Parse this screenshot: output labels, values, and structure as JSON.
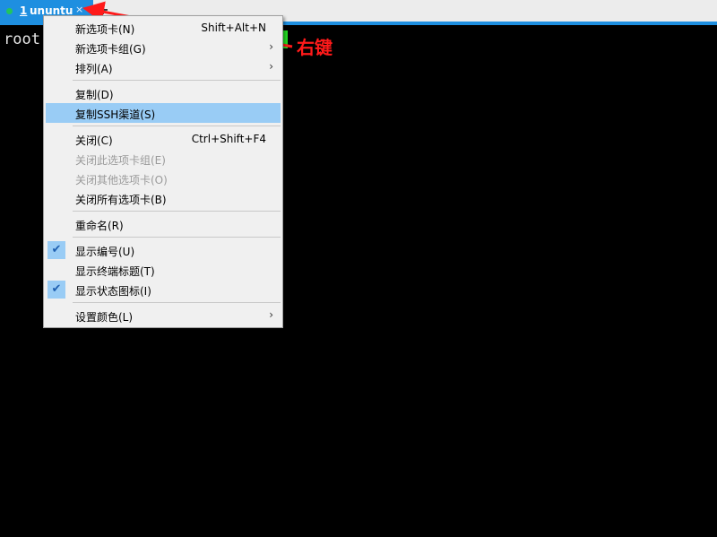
{
  "tabbar": {
    "tab": {
      "number": "1",
      "name": "ununtu",
      "close": "×"
    },
    "new_tab": "+"
  },
  "terminal": {
    "prompt": "root"
  },
  "annotation": {
    "label": "右键",
    "color": "#ff1a1a"
  },
  "menu": {
    "items": [
      {
        "label": "新选项卡(N)",
        "shortcut": "Shift+Alt+N"
      },
      {
        "label": "新选项卡组(G)",
        "submenu": "›"
      },
      {
        "label": "排列(A)",
        "submenu": "›"
      },
      {
        "label": "复制(D)"
      },
      {
        "label": "复制SSH渠道(S)",
        "state": "highlighted"
      },
      {
        "label": "关闭(C)",
        "shortcut": "Ctrl+Shift+F4"
      },
      {
        "label": "关闭此选项卡组(E)",
        "state": "disabled"
      },
      {
        "label": "关闭其他选项卡(O)",
        "state": "disabled"
      },
      {
        "label": "关闭所有选项卡(B)"
      },
      {
        "label": "重命名(R)"
      },
      {
        "label": "显示编号(U)",
        "checked": true,
        "check": "✔"
      },
      {
        "label": "显示终端标题(T)"
      },
      {
        "label": "显示状态图标(I)",
        "checked": true,
        "check": "✔"
      },
      {
        "label": "设置颜色(L)",
        "submenu": "›"
      }
    ]
  },
  "colors": {
    "accent": "#1e8fe0",
    "highlight": "#99ccf5",
    "cursor": "#22dd22"
  }
}
